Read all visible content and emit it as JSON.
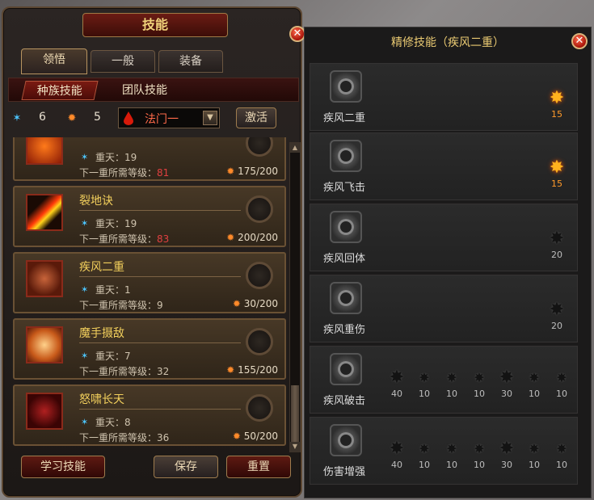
{
  "left": {
    "title": "技能",
    "tabs": [
      "领悟",
      "一般",
      "装备"
    ],
    "subtabs": [
      "种族技能",
      "团队技能"
    ],
    "stats": {
      "star_value": "6",
      "fire_value": "5"
    },
    "dropdown": "法门一",
    "activate": "激活",
    "skills": [
      {
        "name": "",
        "level": "重天：19",
        "req_label": "下一重所需等级：",
        "req_level": "81",
        "points": "175/200"
      },
      {
        "name": "裂地诀",
        "level": "重天：19",
        "req_label": "下一重所需等级：",
        "req_level": "83",
        "points": "200/200"
      },
      {
        "name": "疾风二重",
        "level": "重天：1",
        "req_label": "下一重所需等级：",
        "req_level": "9",
        "points": "30/200"
      },
      {
        "name": "魔手摄敌",
        "level": "重天：7",
        "req_label": "下一重所需等级：",
        "req_level": "32",
        "points": "155/200"
      },
      {
        "name": "怒啸长天",
        "level": "重天：8",
        "req_label": "下一重所需等级：",
        "req_level": "36",
        "points": "50/200"
      }
    ],
    "buttons": {
      "learn": "学习技能",
      "save": "保存",
      "reset": "重置"
    }
  },
  "right": {
    "title": "精修技能（疾风二重）",
    "rows": [
      {
        "name": "疾风二重",
        "stars": [
          {
            "v": "15",
            "lit": true
          }
        ]
      },
      {
        "name": "疾风飞击",
        "stars": [
          {
            "v": "15",
            "lit": true
          }
        ]
      },
      {
        "name": "疾风回体",
        "stars": [
          {
            "v": "20",
            "lit": false
          }
        ]
      },
      {
        "name": "疾风重伤",
        "stars": [
          {
            "v": "20",
            "lit": false
          }
        ]
      },
      {
        "name": "疾风破击",
        "stars": [
          {
            "v": "40"
          },
          {
            "v": "10"
          },
          {
            "v": "10"
          },
          {
            "v": "10"
          },
          {
            "v": "30"
          },
          {
            "v": "10"
          },
          {
            "v": "10"
          }
        ]
      },
      {
        "name": "伤害增强",
        "stars": [
          {
            "v": "40"
          },
          {
            "v": "10"
          },
          {
            "v": "10"
          },
          {
            "v": "10"
          },
          {
            "v": "30"
          },
          {
            "v": "10"
          },
          {
            "v": "10"
          }
        ]
      }
    ]
  }
}
